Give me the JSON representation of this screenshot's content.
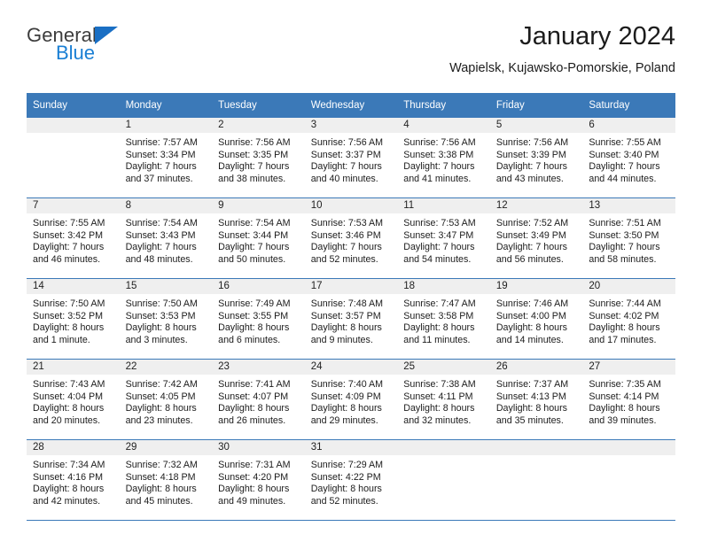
{
  "brand": {
    "name_top": "General",
    "name_bottom": "Blue",
    "triangle_color": "#1a6fc4",
    "blue_color": "#1a7fd4"
  },
  "header": {
    "title": "January 2024",
    "subtitle": "Wapielsk, Kujawsko-Pomorskie, Poland"
  },
  "theme": {
    "header_blue": "#3b79b8",
    "daynum_band": "#efefef",
    "text": "#1c1c1c"
  },
  "calendar": {
    "weekdays": [
      "Sunday",
      "Monday",
      "Tuesday",
      "Wednesday",
      "Thursday",
      "Friday",
      "Saturday"
    ],
    "weeks": [
      [
        {
          "day": "",
          "sunrise": "",
          "sunset": "",
          "daylight1": "",
          "daylight2": ""
        },
        {
          "day": "1",
          "sunrise": "Sunrise: 7:57 AM",
          "sunset": "Sunset: 3:34 PM",
          "daylight1": "Daylight: 7 hours",
          "daylight2": "and 37 minutes."
        },
        {
          "day": "2",
          "sunrise": "Sunrise: 7:56 AM",
          "sunset": "Sunset: 3:35 PM",
          "daylight1": "Daylight: 7 hours",
          "daylight2": "and 38 minutes."
        },
        {
          "day": "3",
          "sunrise": "Sunrise: 7:56 AM",
          "sunset": "Sunset: 3:37 PM",
          "daylight1": "Daylight: 7 hours",
          "daylight2": "and 40 minutes."
        },
        {
          "day": "4",
          "sunrise": "Sunrise: 7:56 AM",
          "sunset": "Sunset: 3:38 PM",
          "daylight1": "Daylight: 7 hours",
          "daylight2": "and 41 minutes."
        },
        {
          "day": "5",
          "sunrise": "Sunrise: 7:56 AM",
          "sunset": "Sunset: 3:39 PM",
          "daylight1": "Daylight: 7 hours",
          "daylight2": "and 43 minutes."
        },
        {
          "day": "6",
          "sunrise": "Sunrise: 7:55 AM",
          "sunset": "Sunset: 3:40 PM",
          "daylight1": "Daylight: 7 hours",
          "daylight2": "and 44 minutes."
        }
      ],
      [
        {
          "day": "7",
          "sunrise": "Sunrise: 7:55 AM",
          "sunset": "Sunset: 3:42 PM",
          "daylight1": "Daylight: 7 hours",
          "daylight2": "and 46 minutes."
        },
        {
          "day": "8",
          "sunrise": "Sunrise: 7:54 AM",
          "sunset": "Sunset: 3:43 PM",
          "daylight1": "Daylight: 7 hours",
          "daylight2": "and 48 minutes."
        },
        {
          "day": "9",
          "sunrise": "Sunrise: 7:54 AM",
          "sunset": "Sunset: 3:44 PM",
          "daylight1": "Daylight: 7 hours",
          "daylight2": "and 50 minutes."
        },
        {
          "day": "10",
          "sunrise": "Sunrise: 7:53 AM",
          "sunset": "Sunset: 3:46 PM",
          "daylight1": "Daylight: 7 hours",
          "daylight2": "and 52 minutes."
        },
        {
          "day": "11",
          "sunrise": "Sunrise: 7:53 AM",
          "sunset": "Sunset: 3:47 PM",
          "daylight1": "Daylight: 7 hours",
          "daylight2": "and 54 minutes."
        },
        {
          "day": "12",
          "sunrise": "Sunrise: 7:52 AM",
          "sunset": "Sunset: 3:49 PM",
          "daylight1": "Daylight: 7 hours",
          "daylight2": "and 56 minutes."
        },
        {
          "day": "13",
          "sunrise": "Sunrise: 7:51 AM",
          "sunset": "Sunset: 3:50 PM",
          "daylight1": "Daylight: 7 hours",
          "daylight2": "and 58 minutes."
        }
      ],
      [
        {
          "day": "14",
          "sunrise": "Sunrise: 7:50 AM",
          "sunset": "Sunset: 3:52 PM",
          "daylight1": "Daylight: 8 hours",
          "daylight2": "and 1 minute."
        },
        {
          "day": "15",
          "sunrise": "Sunrise: 7:50 AM",
          "sunset": "Sunset: 3:53 PM",
          "daylight1": "Daylight: 8 hours",
          "daylight2": "and 3 minutes."
        },
        {
          "day": "16",
          "sunrise": "Sunrise: 7:49 AM",
          "sunset": "Sunset: 3:55 PM",
          "daylight1": "Daylight: 8 hours",
          "daylight2": "and 6 minutes."
        },
        {
          "day": "17",
          "sunrise": "Sunrise: 7:48 AM",
          "sunset": "Sunset: 3:57 PM",
          "daylight1": "Daylight: 8 hours",
          "daylight2": "and 9 minutes."
        },
        {
          "day": "18",
          "sunrise": "Sunrise: 7:47 AM",
          "sunset": "Sunset: 3:58 PM",
          "daylight1": "Daylight: 8 hours",
          "daylight2": "and 11 minutes."
        },
        {
          "day": "19",
          "sunrise": "Sunrise: 7:46 AM",
          "sunset": "Sunset: 4:00 PM",
          "daylight1": "Daylight: 8 hours",
          "daylight2": "and 14 minutes."
        },
        {
          "day": "20",
          "sunrise": "Sunrise: 7:44 AM",
          "sunset": "Sunset: 4:02 PM",
          "daylight1": "Daylight: 8 hours",
          "daylight2": "and 17 minutes."
        }
      ],
      [
        {
          "day": "21",
          "sunrise": "Sunrise: 7:43 AM",
          "sunset": "Sunset: 4:04 PM",
          "daylight1": "Daylight: 8 hours",
          "daylight2": "and 20 minutes."
        },
        {
          "day": "22",
          "sunrise": "Sunrise: 7:42 AM",
          "sunset": "Sunset: 4:05 PM",
          "daylight1": "Daylight: 8 hours",
          "daylight2": "and 23 minutes."
        },
        {
          "day": "23",
          "sunrise": "Sunrise: 7:41 AM",
          "sunset": "Sunset: 4:07 PM",
          "daylight1": "Daylight: 8 hours",
          "daylight2": "and 26 minutes."
        },
        {
          "day": "24",
          "sunrise": "Sunrise: 7:40 AM",
          "sunset": "Sunset: 4:09 PM",
          "daylight1": "Daylight: 8 hours",
          "daylight2": "and 29 minutes."
        },
        {
          "day": "25",
          "sunrise": "Sunrise: 7:38 AM",
          "sunset": "Sunset: 4:11 PM",
          "daylight1": "Daylight: 8 hours",
          "daylight2": "and 32 minutes."
        },
        {
          "day": "26",
          "sunrise": "Sunrise: 7:37 AM",
          "sunset": "Sunset: 4:13 PM",
          "daylight1": "Daylight: 8 hours",
          "daylight2": "and 35 minutes."
        },
        {
          "day": "27",
          "sunrise": "Sunrise: 7:35 AM",
          "sunset": "Sunset: 4:14 PM",
          "daylight1": "Daylight: 8 hours",
          "daylight2": "and 39 minutes."
        }
      ],
      [
        {
          "day": "28",
          "sunrise": "Sunrise: 7:34 AM",
          "sunset": "Sunset: 4:16 PM",
          "daylight1": "Daylight: 8 hours",
          "daylight2": "and 42 minutes."
        },
        {
          "day": "29",
          "sunrise": "Sunrise: 7:32 AM",
          "sunset": "Sunset: 4:18 PM",
          "daylight1": "Daylight: 8 hours",
          "daylight2": "and 45 minutes."
        },
        {
          "day": "30",
          "sunrise": "Sunrise: 7:31 AM",
          "sunset": "Sunset: 4:20 PM",
          "daylight1": "Daylight: 8 hours",
          "daylight2": "and 49 minutes."
        },
        {
          "day": "31",
          "sunrise": "Sunrise: 7:29 AM",
          "sunset": "Sunset: 4:22 PM",
          "daylight1": "Daylight: 8 hours",
          "daylight2": "and 52 minutes."
        },
        {
          "day": "",
          "sunrise": "",
          "sunset": "",
          "daylight1": "",
          "daylight2": ""
        },
        {
          "day": "",
          "sunrise": "",
          "sunset": "",
          "daylight1": "",
          "daylight2": ""
        },
        {
          "day": "",
          "sunrise": "",
          "sunset": "",
          "daylight1": "",
          "daylight2": ""
        }
      ]
    ]
  }
}
